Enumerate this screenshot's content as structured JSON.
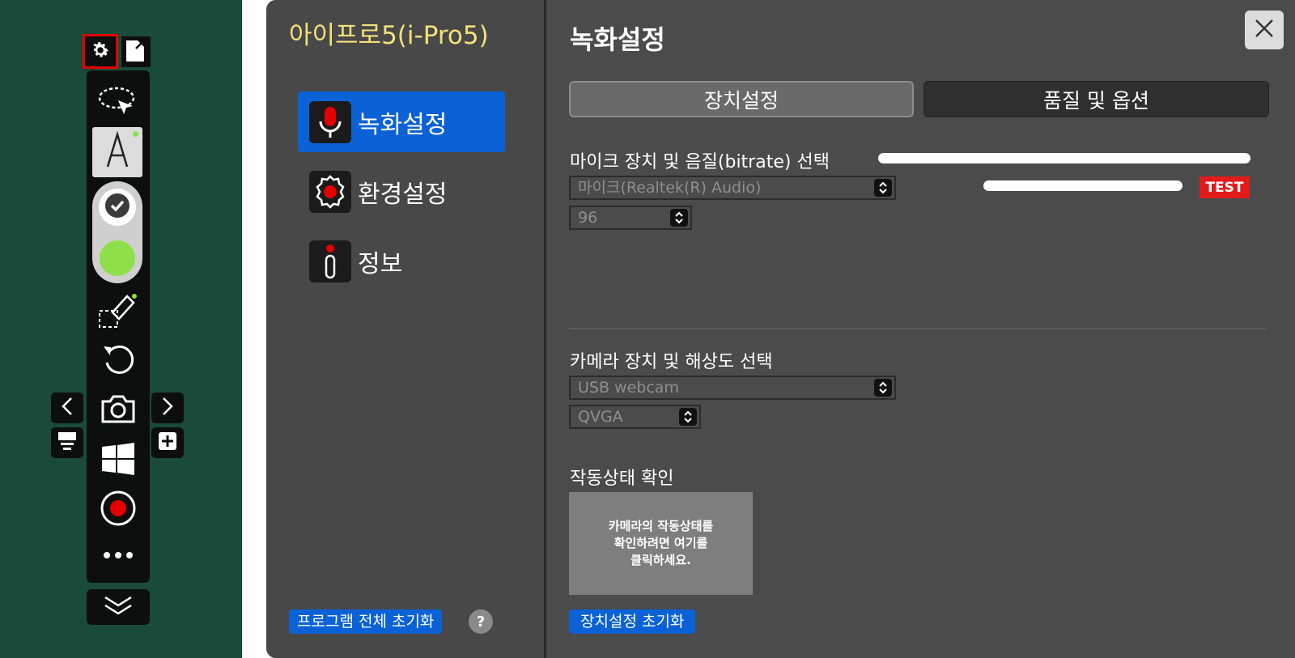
{
  "app": {
    "name": "아이프로5(i-Pro5)"
  },
  "nav": {
    "items": [
      {
        "label": "녹화설정",
        "icon": "microphone-icon",
        "active": true
      },
      {
        "label": "환경설정",
        "icon": "gear-record-icon",
        "active": false
      },
      {
        "label": "정보",
        "icon": "info-icon",
        "active": false
      }
    ],
    "reset_all_label": "프로그램 전체 초기화",
    "help_label": "?"
  },
  "header": {
    "title": "녹화설정"
  },
  "tabs": [
    {
      "label": "장치설정",
      "active": true
    },
    {
      "label": "품질 및 옵션",
      "active": false
    }
  ],
  "mic": {
    "label": "마이크 장치 및 음질(bitrate) 선택",
    "device_value": "마이크(Realtek(R) Audio)",
    "bitrate_value": "96",
    "test_label": "TEST"
  },
  "camera": {
    "label": "카메라 장치 및 해상도 선택",
    "device_value": "USB webcam",
    "resolution_value": "QVGA"
  },
  "status": {
    "label": "작동상태 확인",
    "preview_text_lines": [
      "카메라의 작동상태를",
      "확인하려면 여기를",
      "클릭하세요."
    ]
  },
  "reset_device_label": "장치설정 초기화",
  "colors": {
    "board": "#1a4a3a",
    "accent_blue": "#0b62d6",
    "app_name_yellow": "#f2e27a",
    "test_red": "#e41b1b",
    "pen_green": "#8de04a"
  },
  "toolbar": {
    "icons": [
      "settings-icon",
      "export-icon",
      "lasso-select-icon",
      "text-icon",
      "check-icon",
      "color-swatch-icon",
      "eraser-icon",
      "undo-icon",
      "camera-icon",
      "windows-icon",
      "record-icon",
      "more-icon",
      "collapse-icon",
      "prev-page-icon",
      "next-page-icon",
      "board-icon",
      "add-page-icon"
    ]
  }
}
